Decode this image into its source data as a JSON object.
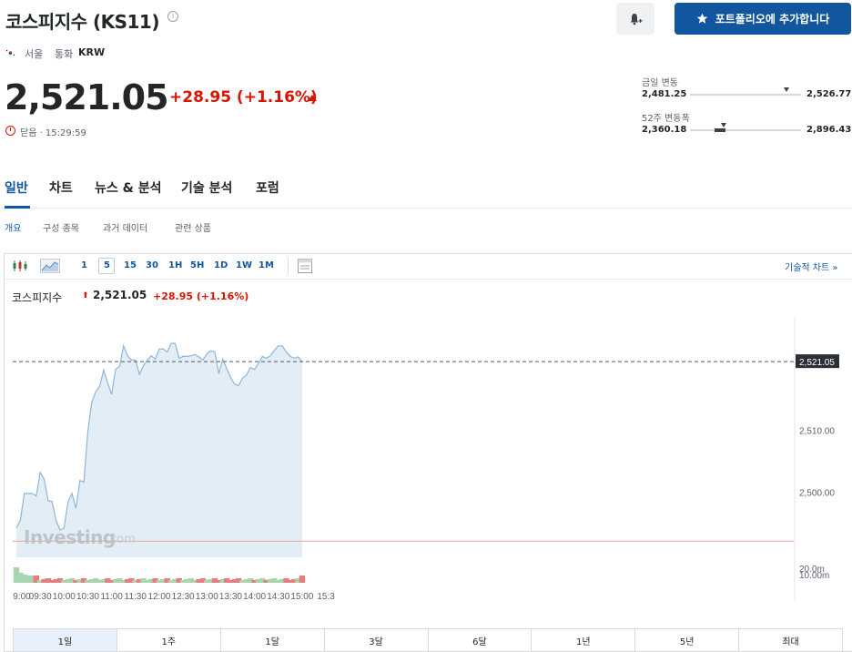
{
  "header": {
    "title": "코스피지수 (KS11)",
    "info_icon": "info-icon",
    "bell_icon": "bell-plus-icon",
    "portfolio_button": "포트폴리오에 추가합니다",
    "exchange": "서울",
    "currency_label": "통화",
    "currency": "KRW"
  },
  "quote": {
    "price": "2,521.05",
    "change": "+28.95 (+1.16%)",
    "status": "닫음 · 15:29:59",
    "color_down": "#d91400"
  },
  "ranges": {
    "day": {
      "label": "금일 변동",
      "low": "2,481.25",
      "high": "2,526.77",
      "current_fraction": 0.87
    },
    "week52": {
      "label": "52주 변동폭",
      "low": "2,360.18",
      "high": "2,896.43",
      "current_fraction": 0.3
    }
  },
  "tabs": [
    "일반",
    "차트",
    "뉴스 & 분석",
    "기술 분석",
    "포럼"
  ],
  "sub_tabs": [
    "개요",
    "구성 종목",
    "과거 데이터",
    "관련 상품"
  ],
  "toolbar": {
    "intervals": [
      "1",
      "5",
      "15",
      "30",
      "1H",
      "5H",
      "1D",
      "1W",
      "1M"
    ],
    "active_interval": "5",
    "tech_link": "기술적 차트 »"
  },
  "legend": {
    "name": "코스피지수",
    "price": "2,521.05",
    "change": "+28.95 (+1.16%)"
  },
  "watermark": {
    "brand": "Investing",
    "suffix": ".com"
  },
  "periods": [
    "1일",
    "1주",
    "1달",
    "3달",
    "6달",
    "1년",
    "5년",
    "최대"
  ],
  "active_period": "1일",
  "chart_data": {
    "type": "area",
    "x_ticks": [
      "9:00",
      "09:30",
      "10:00",
      "10:30",
      "11:00",
      "11:30",
      "12:00",
      "12:30",
      "13:00",
      "13:30",
      "14:00",
      "14:30",
      "15:00",
      "15:3"
    ],
    "y_ticks": [
      "2,510.00",
      "2,500.00"
    ],
    "y_ticks_values": [
      2510,
      2500
    ],
    "current_label": "2,521.05",
    "current_value": 2521.05,
    "reference_value": 2492.1,
    "volume_labels": [
      "20.0m",
      "10.00m"
    ],
    "color_line": "#8fb6d8",
    "color_fill": "#e3edf6",
    "color_vol_up": "#a8d5b0",
    "color_vol_down": "#e87d7d",
    "x_minutes": [
      0,
      5,
      10,
      15,
      20,
      25,
      30,
      35,
      40,
      45,
      50,
      55,
      60,
      65,
      70,
      75,
      80,
      85,
      90,
      95,
      100,
      105,
      110,
      115,
      120,
      125,
      130,
      135,
      140,
      145,
      150,
      155,
      160,
      165,
      170,
      175,
      180,
      185,
      190,
      195,
      200,
      205,
      210,
      215,
      220,
      225,
      230,
      235,
      240,
      245,
      250,
      255,
      260,
      265,
      270,
      275,
      280,
      285,
      290,
      295,
      300,
      305,
      310,
      315,
      320,
      325,
      330,
      335,
      340,
      345,
      350,
      355,
      360,
      365,
      370,
      375,
      380,
      385
    ],
    "values": [
      2494.2,
      2495.5,
      2499.8,
      2499.8,
      2499.8,
      2499.4,
      2503.2,
      2502.1,
      2498.6,
      2498.5,
      2495.4,
      2493.9,
      2494.2,
      2498.4,
      2499.8,
      2497.4,
      2501.9,
      2501.6,
      2509.8,
      2514.5,
      2516.2,
      2517.1,
      2519.7,
      2517.6,
      2515.8,
      2519.8,
      2520.3,
      2523.6,
      2522.0,
      2521.3,
      2521.3,
      2519.0,
      2520.4,
      2521.3,
      2522.0,
      2521.5,
      2523.1,
      2523.1,
      2522.6,
      2524.0,
      2524.0,
      2521.6,
      2521.9,
      2521.9,
      2522.0,
      2522.2,
      2521.8,
      2521.3,
      2522.3,
      2522.8,
      2522.6,
      2519.1,
      2521.5,
      2519.9,
      2518.5,
      2517.4,
      2517.2,
      2518.4,
      2518.9,
      2520.1,
      2519.8,
      2520.8,
      2521.9,
      2521.6,
      2522.0,
      2522.9,
      2523.6,
      2523.6,
      2522.6,
      2521.9,
      2521.6,
      2521.8,
      2521.05
    ]
  }
}
